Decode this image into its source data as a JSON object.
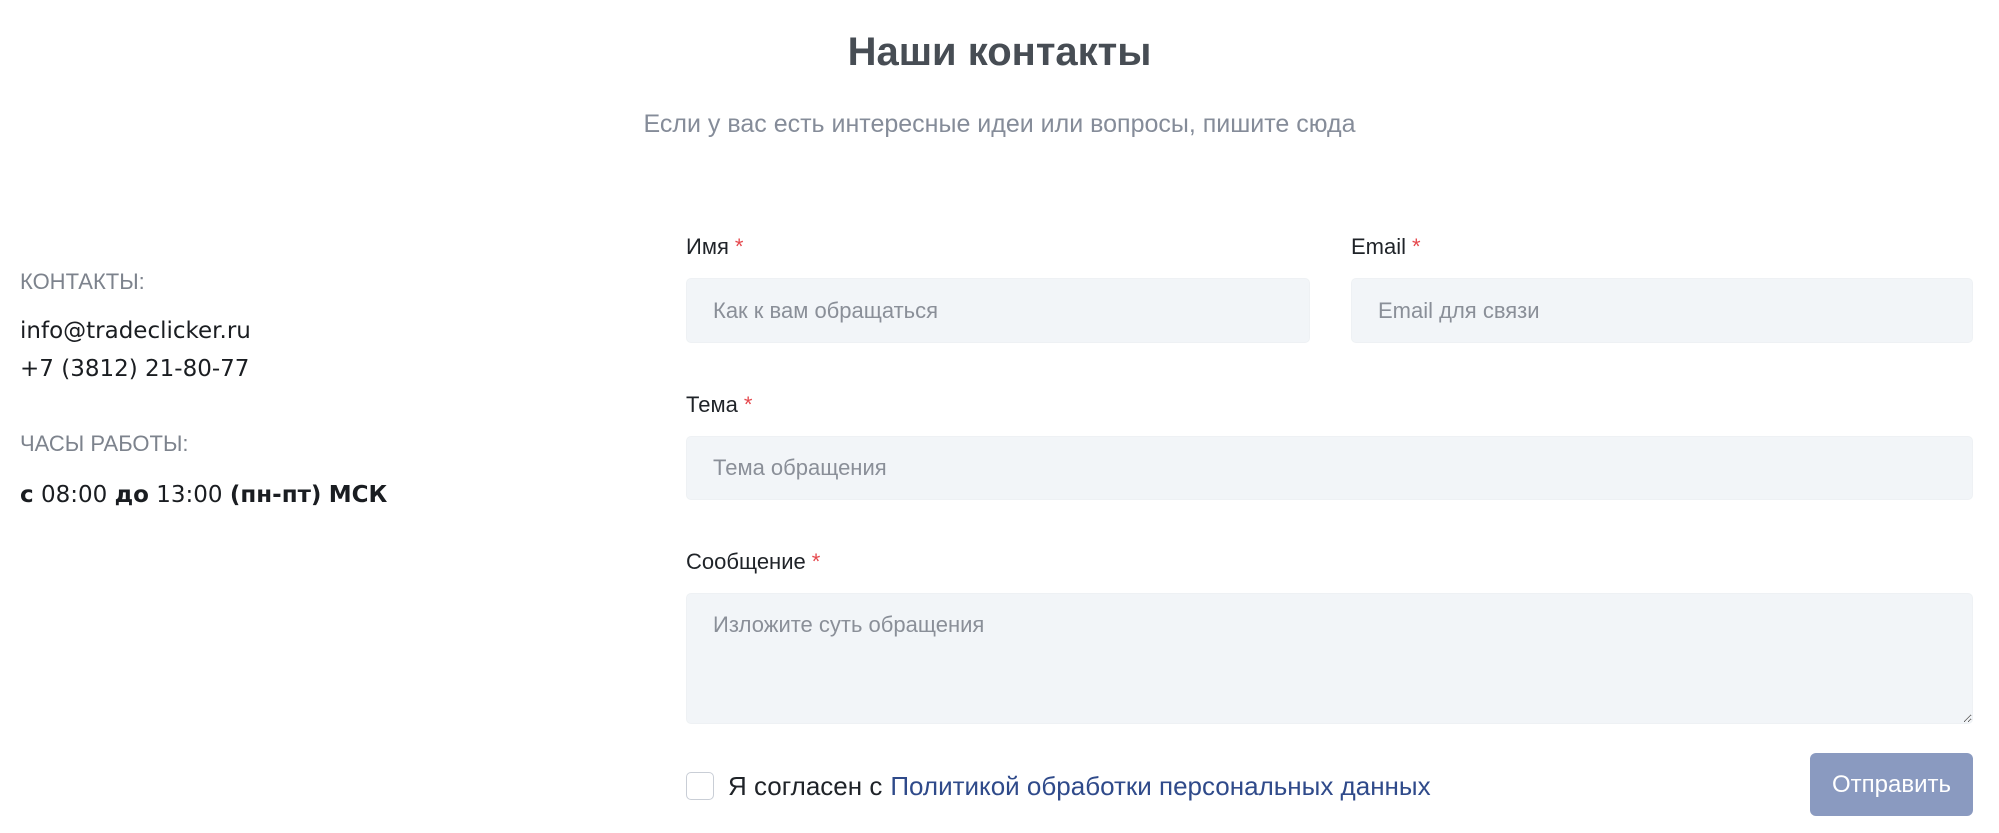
{
  "header": {
    "title": "Наши контакты",
    "subtitle": "Если у вас есть интересные идеи или вопросы, пишите сюда"
  },
  "contacts": {
    "label": "КОНТАКТЫ:",
    "email": "info@tradeclicker.ru",
    "phone": "+7 (3812) 21-80-77",
    "hours_label": "ЧАСЫ РАБОТЫ:",
    "hours": {
      "from_word": "с",
      "from_time": "08:00",
      "to_word": "до",
      "to_time": "13:00",
      "days": "(пн-пт)",
      "tz": "МСК"
    }
  },
  "form": {
    "required_mark": "*",
    "name": {
      "label": "Имя",
      "placeholder": "Как к вам обращаться",
      "value": ""
    },
    "email": {
      "label": "Email",
      "placeholder": "Email для связи",
      "value": ""
    },
    "subject": {
      "label": "Тема",
      "placeholder": "Тема обращения",
      "value": ""
    },
    "message": {
      "label": "Сообщение",
      "placeholder": "Изложите суть обращения",
      "value": ""
    },
    "consent": {
      "checked": false,
      "text": "Я согласен с",
      "link_text": "Политикой обработки персональных данных"
    },
    "submit_label": "Отправить"
  },
  "colors": {
    "required": "#e5484d",
    "link": "#2f4a8a",
    "button": "#8a9ac0",
    "input_bg": "#f2f5f8"
  }
}
